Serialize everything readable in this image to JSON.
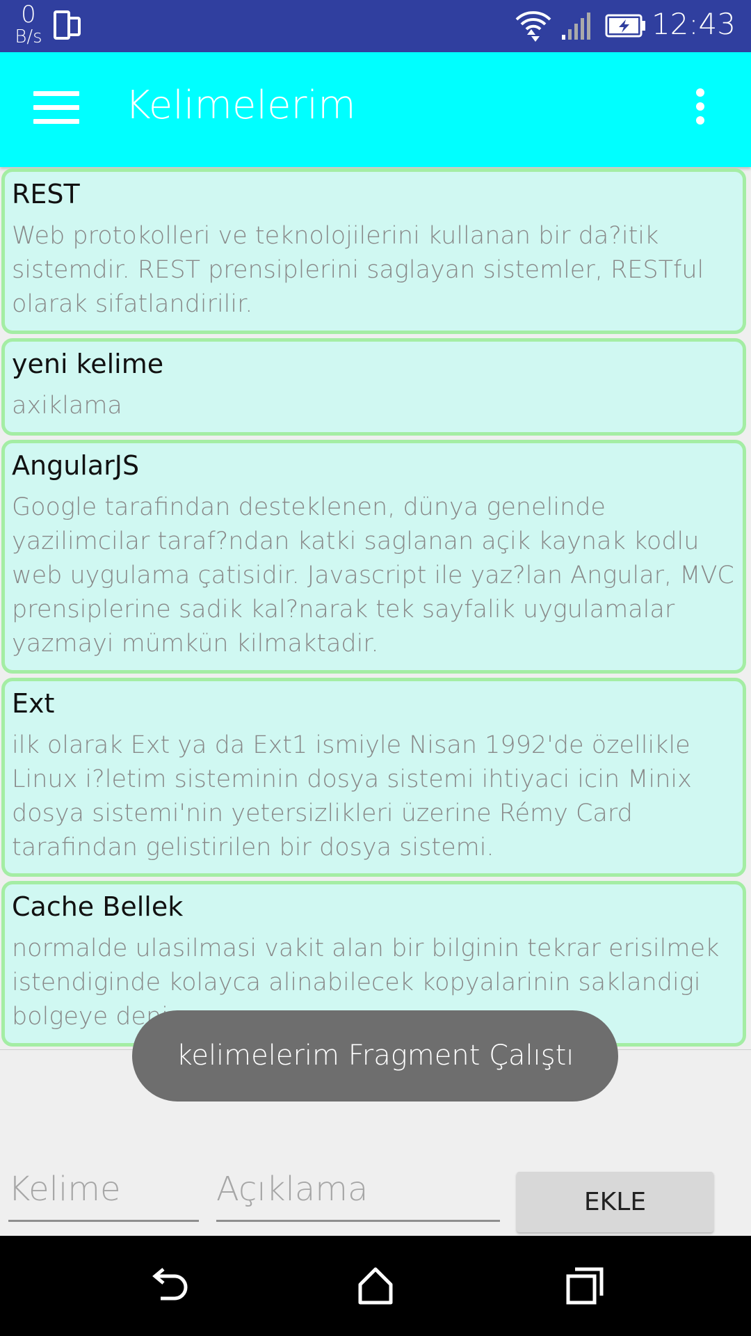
{
  "status_bar": {
    "net_speed_value": "0",
    "net_speed_unit": "B/s",
    "time": "12:43",
    "icons": [
      "phone-sync-icon",
      "wifi-icon",
      "signal-icon",
      "battery-charging-icon"
    ]
  },
  "app_bar": {
    "title": "Kelimelerim",
    "menu_icon": "menu-icon",
    "overflow_icon": "more-vert-icon",
    "color": "#00ffff"
  },
  "words": [
    {
      "word": "REST",
      "description": "Web protokolleri ve teknolojilerini kullanan bir da?itik sistemdir. REST prensiplerini saglayan sistemler, RESTful olarak sifatlandirilir."
    },
    {
      "word": "yeni kelime",
      "description": "axiklama"
    },
    {
      "word": "AngularJS",
      "description": "Google tarafindan desteklenen, dünya genelinde yazilimcilar taraf?ndan katki saglanan açik kaynak kodlu web uygulama çatisidir. Javascript ile yaz?lan Angular, MVC prensiplerine sadik kal?narak tek sayfalik uygulamalar yazmayi mümkün kilmaktadir."
    },
    {
      "word": "Ext",
      "description": "ilk olarak Ext ya da Ext1 ismiyle Nisan 1992'de özellikle Linux i?letim sisteminin dosya sistemi ihtiyaci icin Minix dosya sistemi'nin yetersizlikleri üzerine Rémy Card tarafindan gelistirilen bir dosya sistemi."
    },
    {
      "word": "Cache Bellek",
      "description": "normalde ulasilmasi vakit alan bir bilginin tekrar erisilmek istendiginde kolayca alinabilecek kopyalarinin saklandigi bolgeye denir"
    }
  ],
  "toast": {
    "message": "kelimelerim Fragment Çalıştı"
  },
  "form": {
    "word_placeholder": "Kelime",
    "description_placeholder": "Açıklama",
    "add_button": "EKLE"
  },
  "nav_bar": {
    "icons": [
      "back-icon",
      "home-icon",
      "recents-icon"
    ]
  }
}
